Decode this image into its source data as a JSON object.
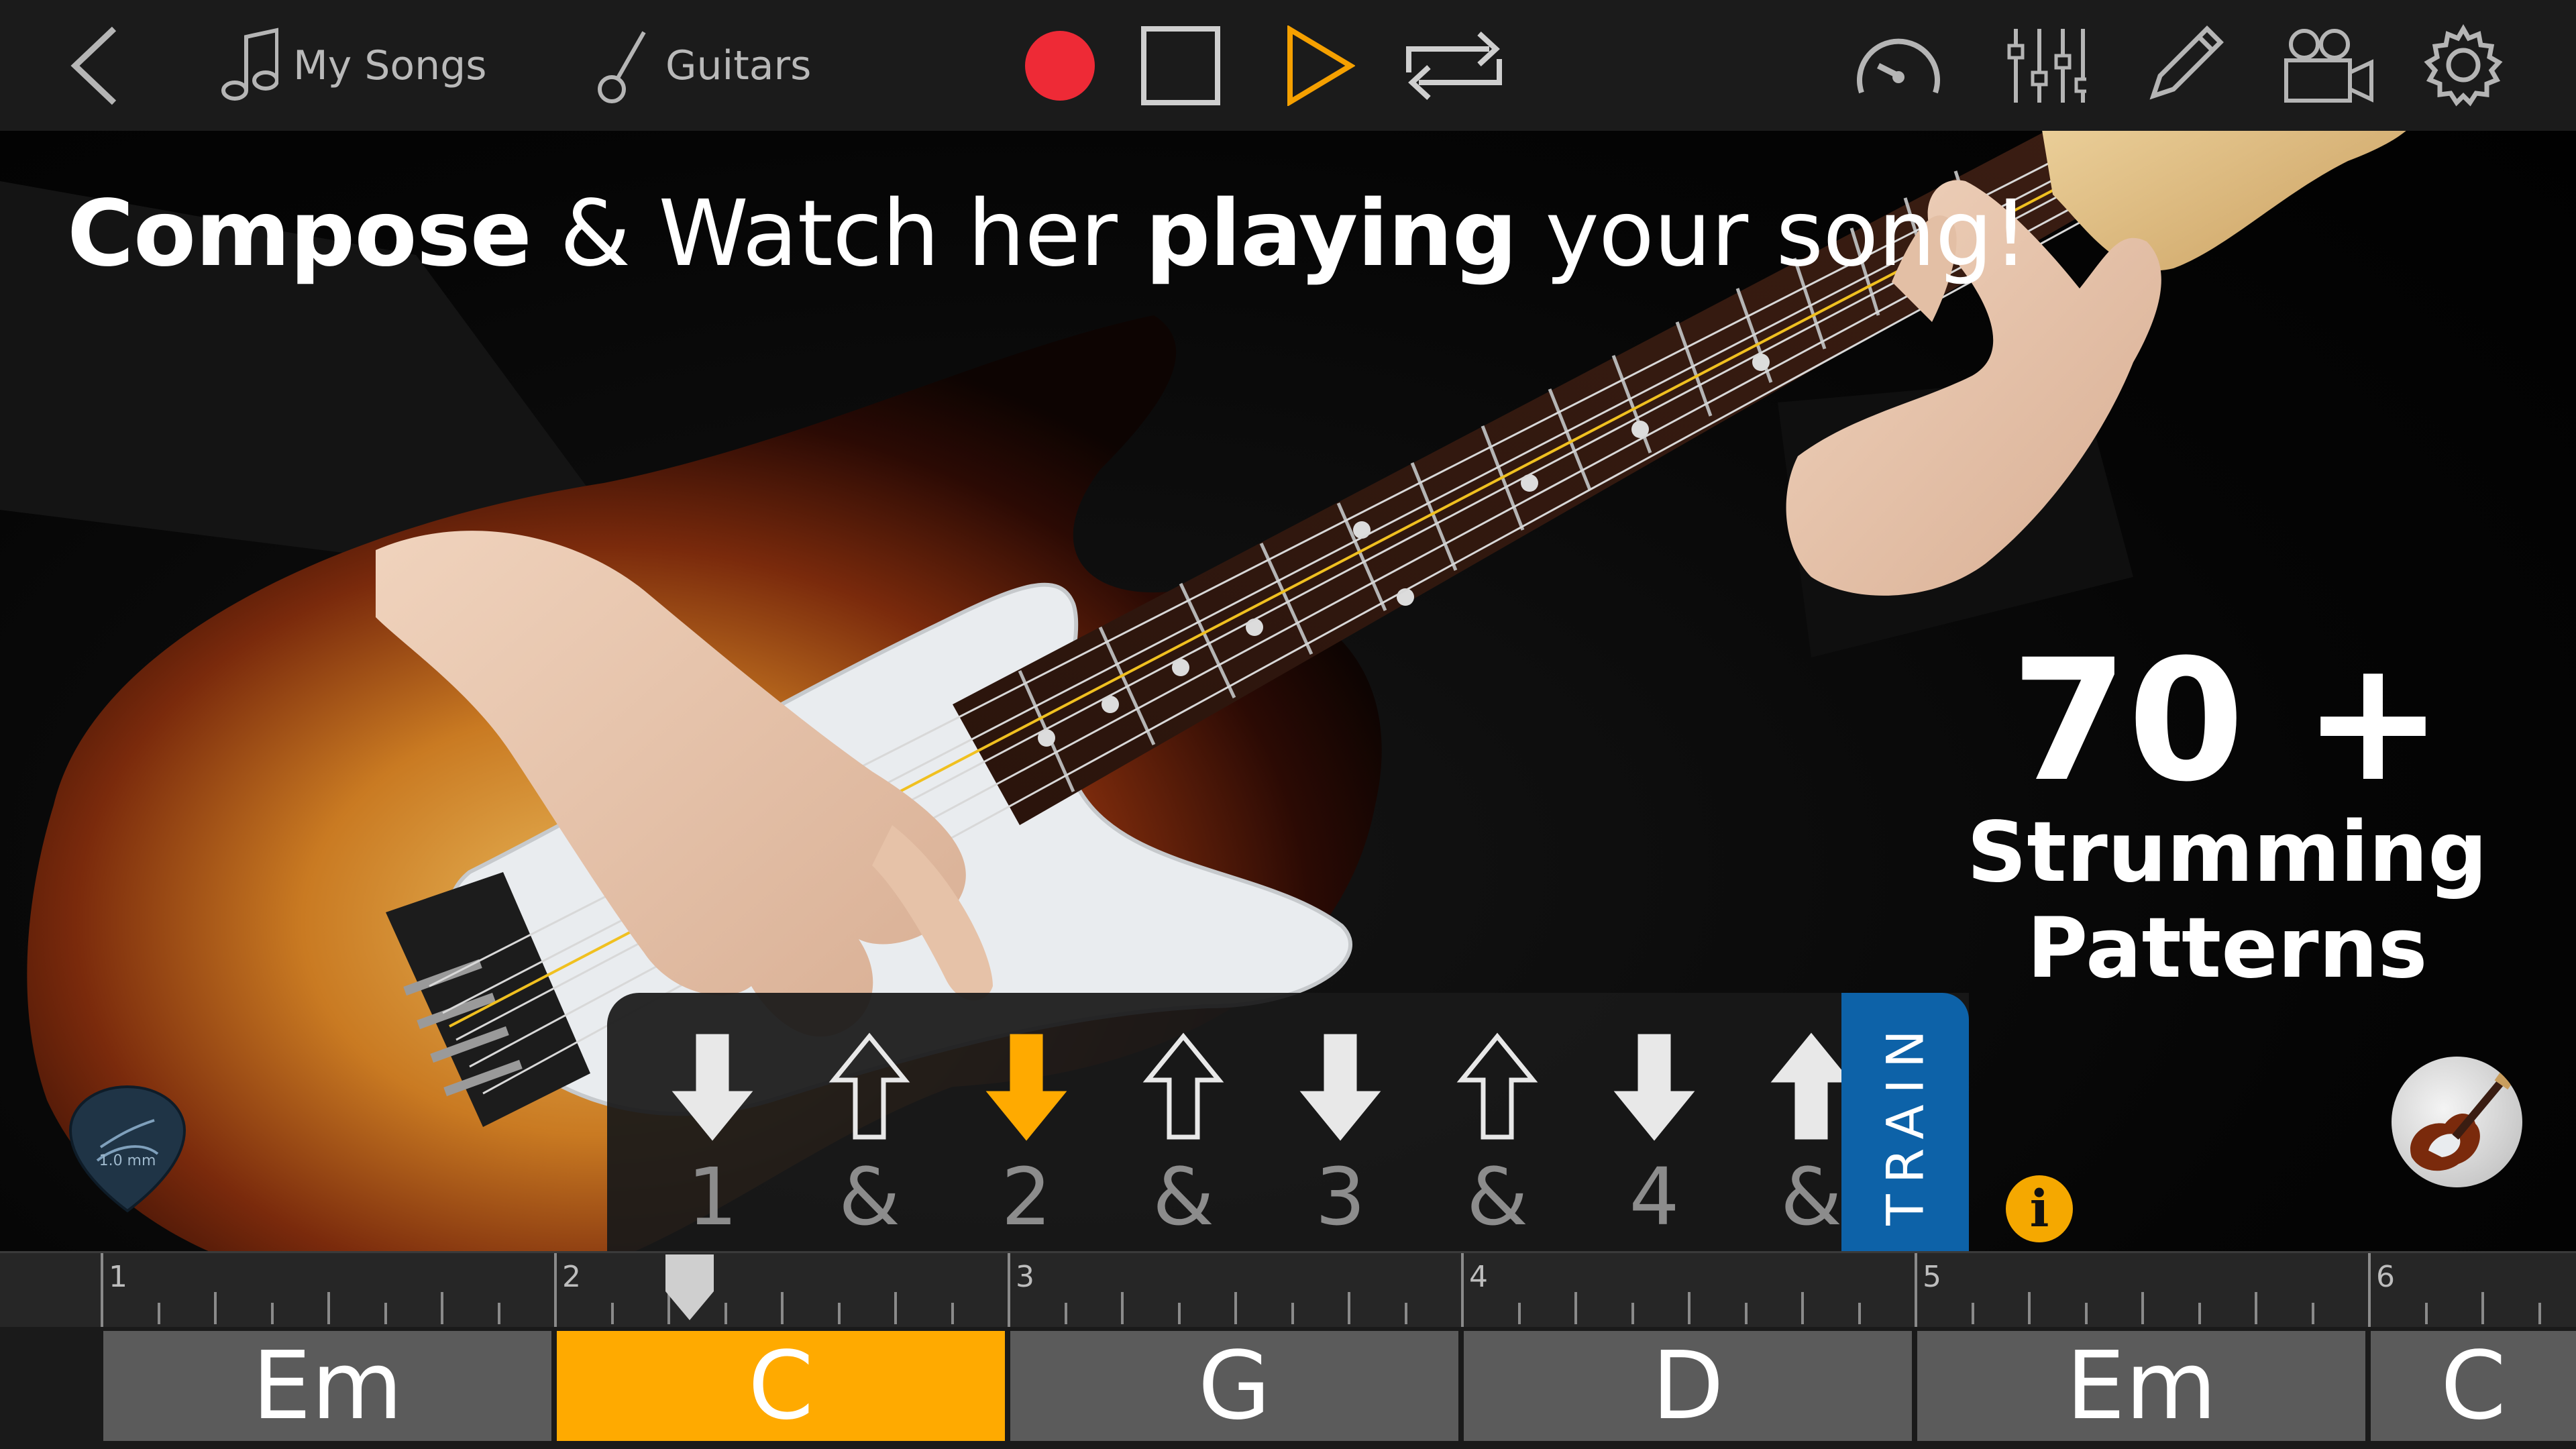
{
  "nav": {
    "my_songs": "My Songs",
    "guitars": "Guitars"
  },
  "headline": {
    "part1": "Compose",
    "part2": " & Watch her ",
    "part3": "playing",
    "part4": " your song!"
  },
  "promo": {
    "count": "70 +",
    "line1": "Strumming",
    "line2": "Patterns"
  },
  "pick_label": "1.0 mm",
  "strum_pattern": [
    {
      "count": "1",
      "direction": "down",
      "style": "solid"
    },
    {
      "count": "&",
      "direction": "up",
      "style": "outline"
    },
    {
      "count": "2",
      "direction": "down",
      "style": "active"
    },
    {
      "count": "&",
      "direction": "up",
      "style": "outline"
    },
    {
      "count": "3",
      "direction": "down",
      "style": "solid"
    },
    {
      "count": "&",
      "direction": "up",
      "style": "outline"
    },
    {
      "count": "4",
      "direction": "down",
      "style": "solid"
    },
    {
      "count": "&",
      "direction": "up",
      "style": "solid"
    }
  ],
  "train_label": "TRAIN",
  "info_label": "i",
  "timeline": {
    "bars": [
      "1",
      "2",
      "3",
      "4",
      "5",
      "6"
    ],
    "chords": [
      {
        "name": "Em",
        "active": false
      },
      {
        "name": "C",
        "active": true
      },
      {
        "name": "G",
        "active": false
      },
      {
        "name": "D",
        "active": false
      },
      {
        "name": "Em",
        "active": false
      },
      {
        "name": "C",
        "active": false
      }
    ]
  },
  "colors": {
    "accent": "#ffaa00",
    "record": "#ee2a36",
    "train": "#0d62a8",
    "chord": "#5b5b5b"
  }
}
